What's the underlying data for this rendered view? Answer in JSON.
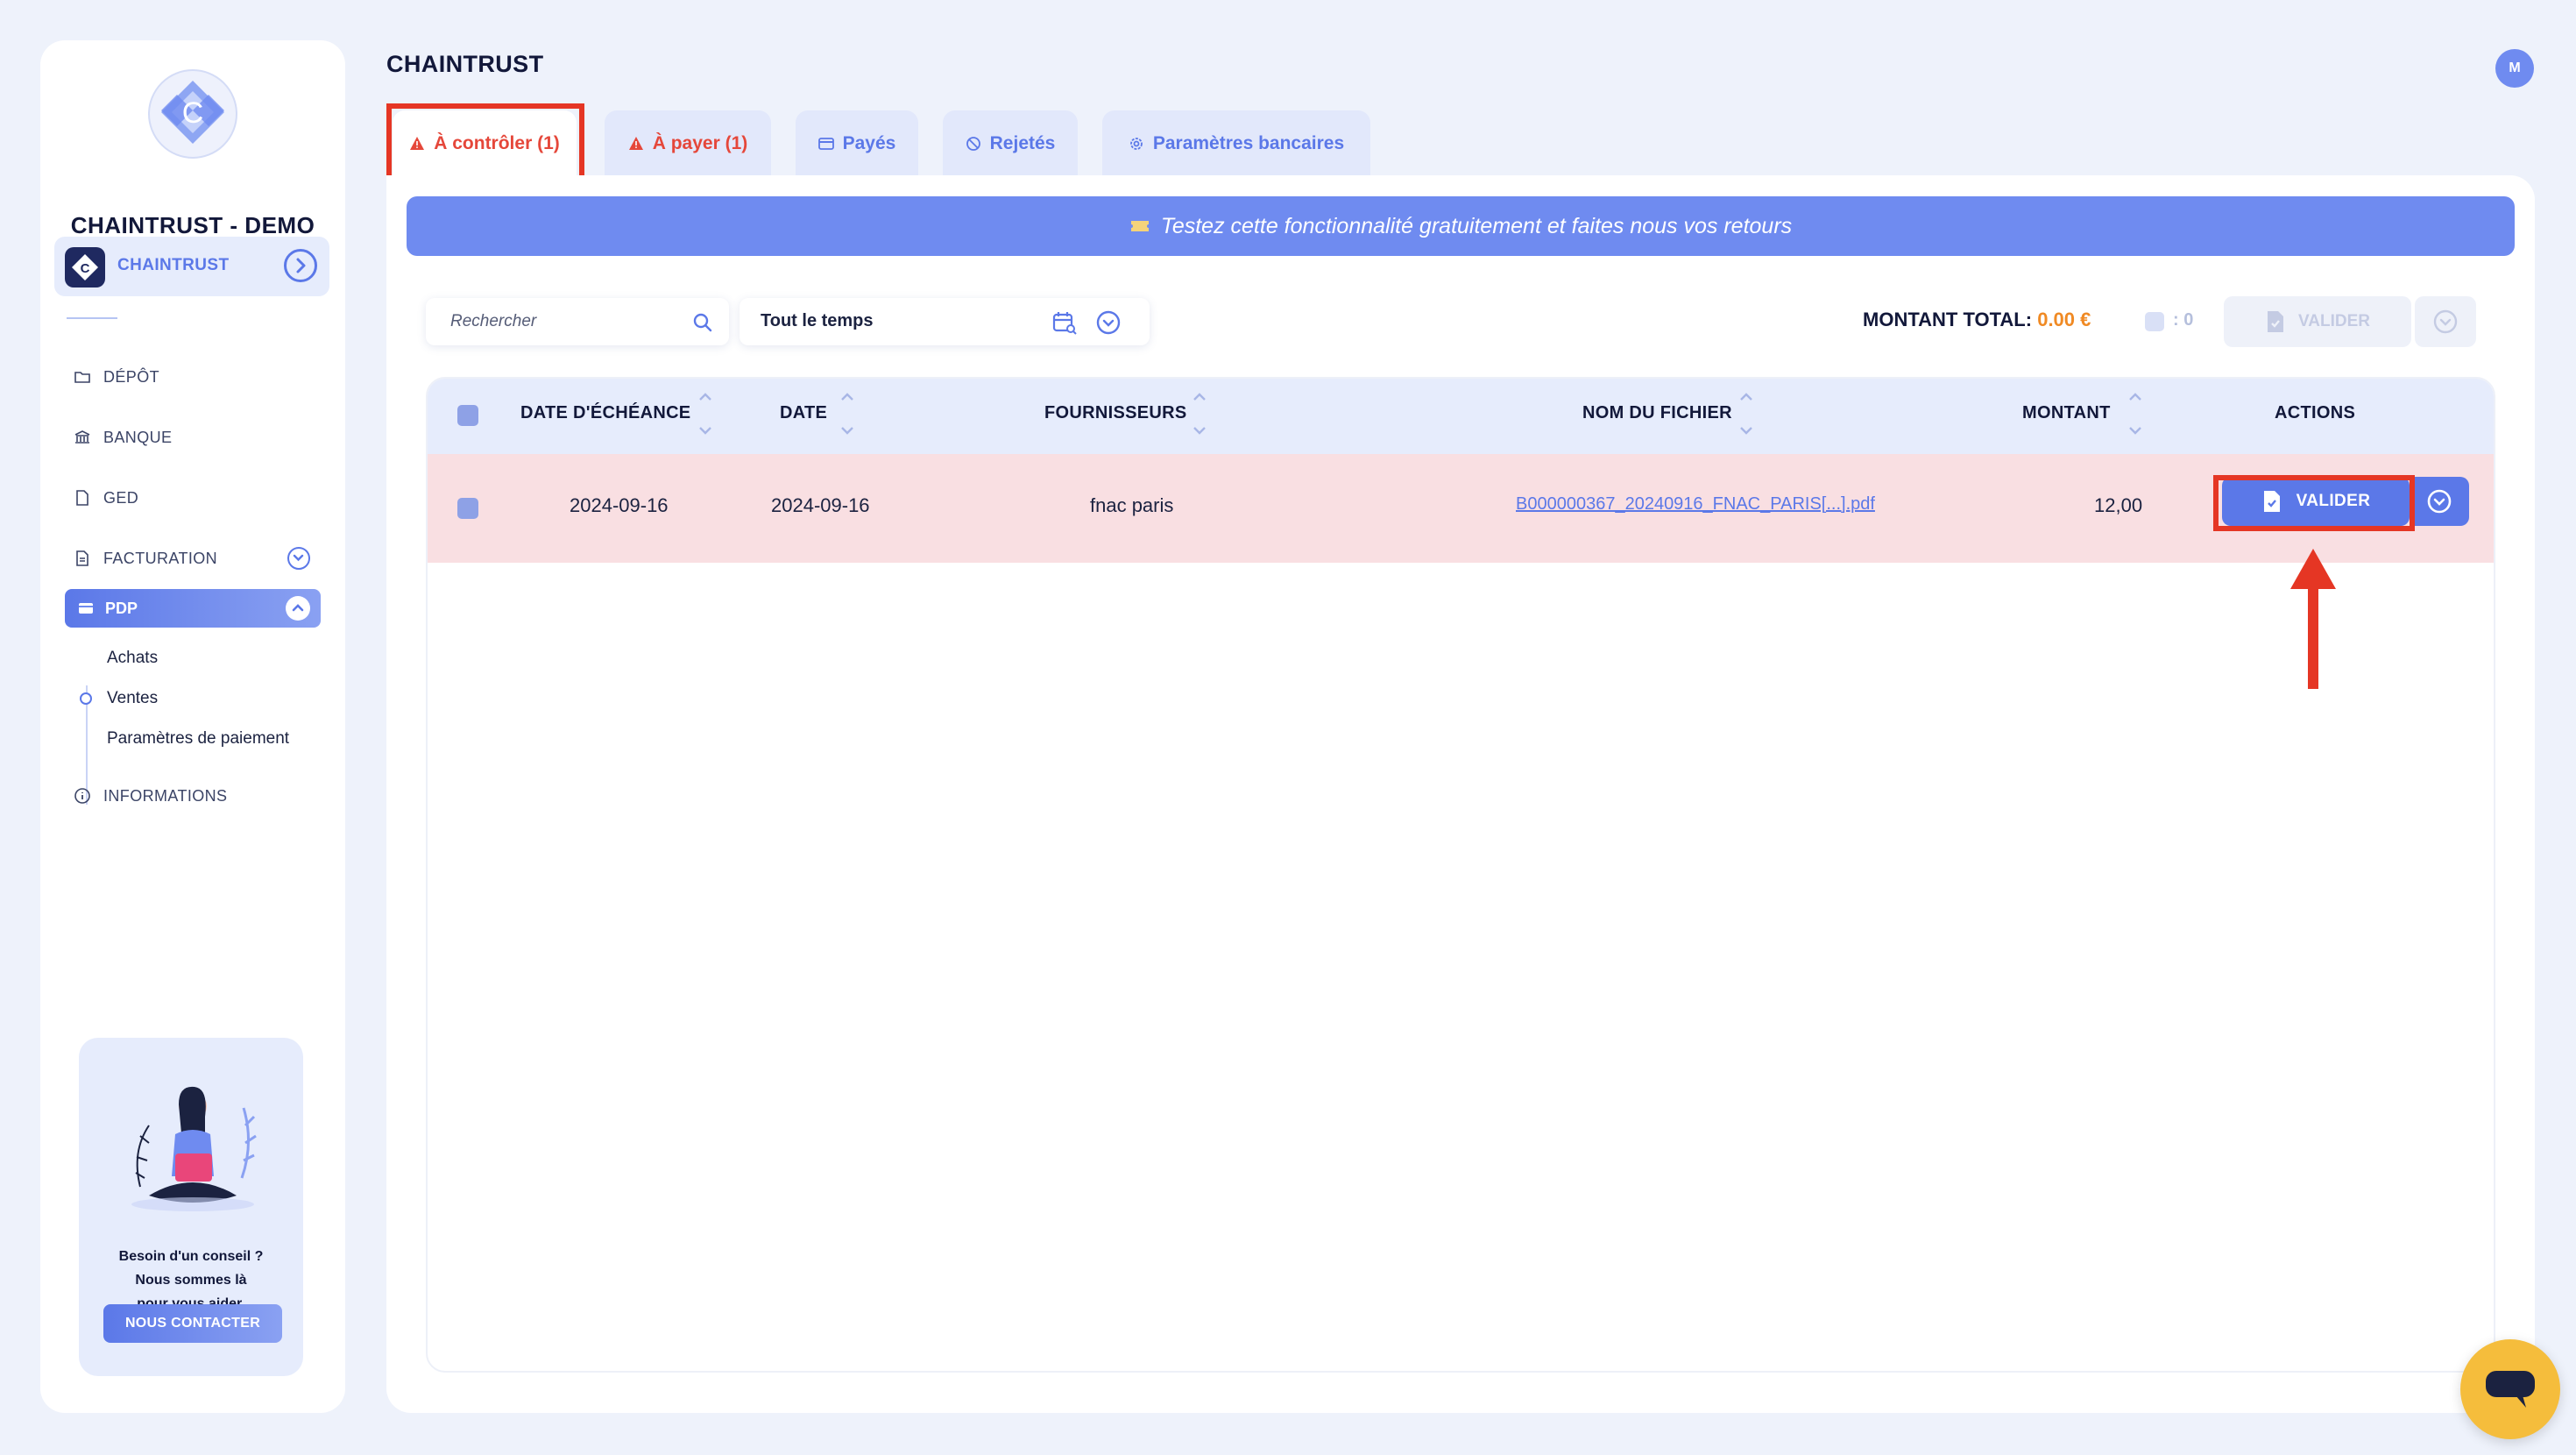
{
  "sidebar": {
    "brand": "CHAINTRUST - DEMO",
    "company": "CHAINTRUST",
    "nav": {
      "depot": "DÉPÔT",
      "banque": "BANQUE",
      "ged": "GED",
      "facturation": "FACTURATION",
      "pdp": "PDP",
      "informations": "INFORMATIONS"
    },
    "pdp_sub": [
      "Achats",
      "Ventes",
      "Paramètres de paiement"
    ],
    "help": {
      "line1": "Besoin d'un conseil ?",
      "line2": "Nous sommes là",
      "line3": "pour vous aider.",
      "button": "NOUS CONTACTER"
    }
  },
  "header": {
    "title": "CHAINTRUST",
    "user_initial": "M"
  },
  "tabs": [
    {
      "label": "À contrôler (1)",
      "icon": "warning-icon",
      "active": true
    },
    {
      "label": "À payer (1)",
      "icon": "warning-icon",
      "active": false
    },
    {
      "label": "Payés",
      "icon": "card-icon",
      "active": false
    },
    {
      "label": "Rejetés",
      "icon": "block-icon",
      "active": false
    },
    {
      "label": "Paramètres bancaires",
      "icon": "gear-icon",
      "active": false
    }
  ],
  "banner": {
    "text": "Testez cette fonctionnalité gratuitement et faites nous vos retours",
    "icon": "ticket-icon"
  },
  "toolbar": {
    "search_placeholder": "Rechercher",
    "search_value": "",
    "period": "Tout le temps",
    "total_label": "MONTANT TOTAL:",
    "total_value": "0.00 €",
    "selected_count": ": 0",
    "valider": "VALIDER"
  },
  "table": {
    "columns": [
      "DATE D'ÉCHÉANCE",
      "DATE",
      "FOURNISSEURS",
      "NOM DU FICHIER",
      "MONTANT",
      "ACTIONS"
    ],
    "rows": [
      {
        "due_date": "2024-09-16",
        "date": "2024-09-16",
        "supplier": "fnac paris",
        "file": "B000000367_20240916_FNAC_PARIS[...].pdf",
        "amount": "12,00",
        "action": "VALIDER"
      }
    ]
  },
  "colors": {
    "accent": "#5b78e8",
    "warning": "#e5473a",
    "highlight": "#e53624",
    "total": "#f08a24",
    "row_bg": "#f9dfe2"
  }
}
